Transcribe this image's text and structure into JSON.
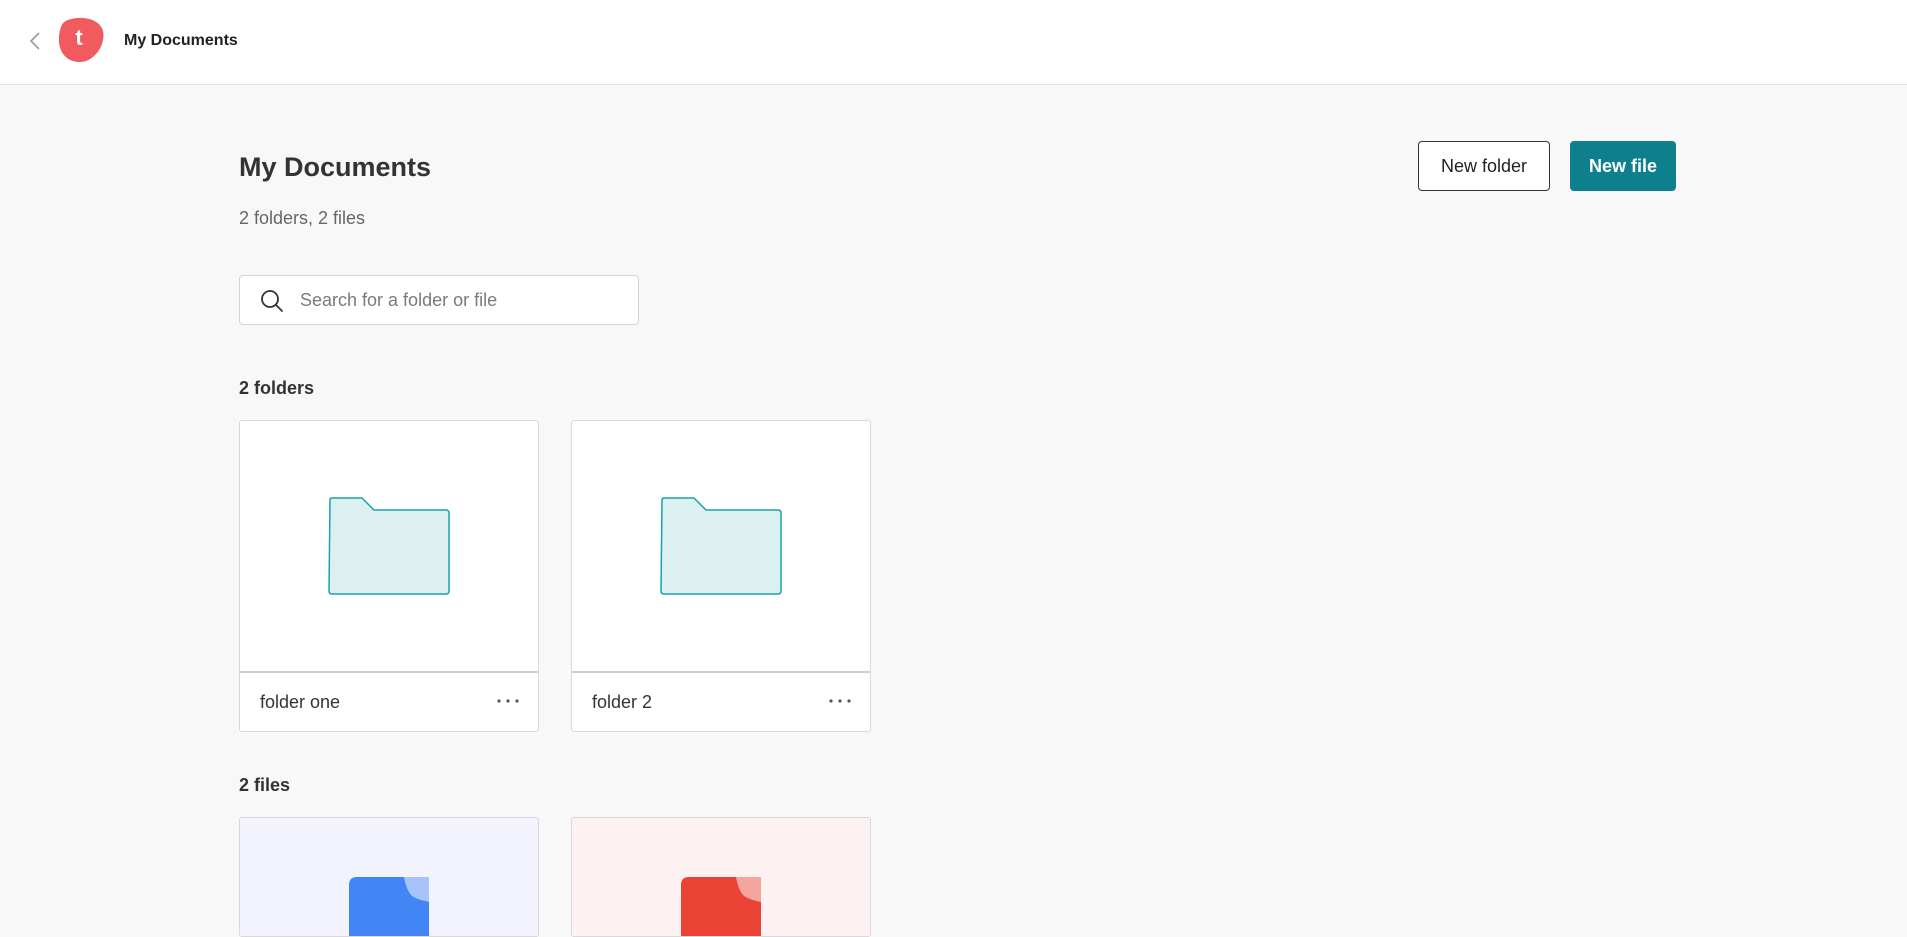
{
  "header": {
    "title": "My Documents",
    "back_icon": "chevron-left-icon",
    "logo_letter": "t",
    "logo_color": "#f15a5f"
  },
  "page": {
    "title": "My Documents",
    "summary": "2 folders, 2 files"
  },
  "actions": {
    "new_folder_label": "New folder",
    "new_file_label": "New file",
    "accent_color": "#0e7f8c"
  },
  "search": {
    "placeholder": "Search for a folder or file",
    "value": ""
  },
  "folders": {
    "heading": "2 folders",
    "items": [
      {
        "name": "folder one"
      },
      {
        "name": "folder 2"
      }
    ]
  },
  "files": {
    "heading": "2 files",
    "items": [
      {
        "type": "document",
        "color": "#4285f4"
      },
      {
        "type": "presentation",
        "color": "#ea4335"
      }
    ]
  }
}
